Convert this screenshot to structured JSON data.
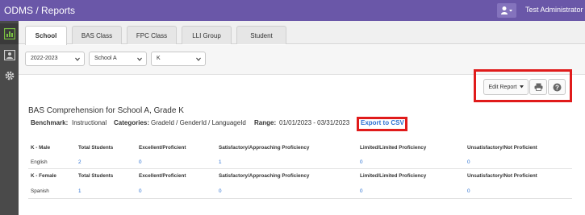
{
  "header": {
    "app_title": "ODMS / Reports",
    "user_name": "Test Administrator"
  },
  "tabs": [
    {
      "label": "School",
      "active": true
    },
    {
      "label": "BAS Class",
      "active": false
    },
    {
      "label": "FPC Class",
      "active": false
    },
    {
      "label": "LLI Group",
      "active": false
    },
    {
      "label": "Student",
      "active": false
    }
  ],
  "filters": {
    "year": "2022-2023",
    "school": "School A",
    "grade": "K"
  },
  "toolbar": {
    "edit_report_label": "Edit Report",
    "print_icon": "print-icon",
    "help_icon": "help-icon"
  },
  "report": {
    "title": "BAS Comprehension for School A, Grade K",
    "benchmark_label": "Benchmark:",
    "benchmark_value": "Instructional",
    "categories_label": "Categories:",
    "categories_value": "GradeId / GenderId / LanguageId",
    "range_label": "Range:",
    "range_value": "01/01/2023 - 03/31/2023",
    "export_label": "Export to CSV"
  },
  "table": {
    "groups": [
      {
        "group_label": "K - Male",
        "columns": [
          "Total Students",
          "Excellent/Proficient",
          "Satisfactory/Approaching Proficiency",
          "Limited/Limited Proficiency",
          "Unsatisfactory/Not Proficient"
        ],
        "row": {
          "label": "English",
          "values": [
            "2",
            "0",
            "1",
            "0",
            "0"
          ]
        }
      },
      {
        "group_label": "K - Female",
        "columns": [
          "Total Students",
          "Excellent/Proficient",
          "Satisfactory/Approaching Proficiency",
          "Limited/Limited Proficiency",
          "Unsatisfactory/Not Proficient"
        ],
        "row": {
          "label": "Spanish",
          "values": [
            "1",
            "0",
            "0",
            "0",
            "0"
          ]
        }
      }
    ]
  },
  "colors": {
    "topbar": "#6a57a8",
    "highlight": "#e01b1b",
    "link": "#2a6fd1"
  }
}
